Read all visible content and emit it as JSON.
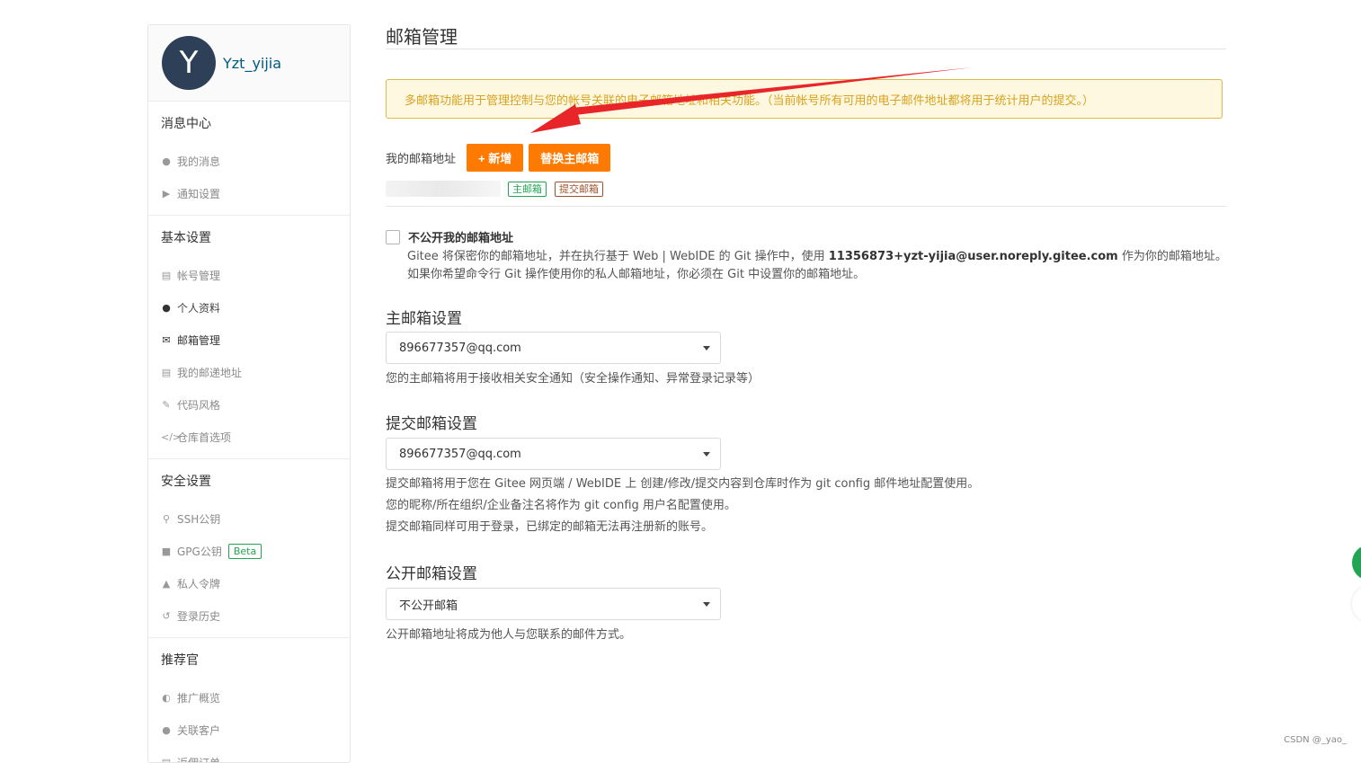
{
  "sidebar": {
    "avatar_letter": "Y",
    "username": "Yzt_yijia",
    "sections": [
      {
        "title": "消息中心",
        "items": [
          {
            "label": "我的消息",
            "icon": "bell-icon"
          },
          {
            "label": "通知设置",
            "icon": "speaker-icon"
          }
        ]
      },
      {
        "title": "基本设置",
        "items": [
          {
            "label": "帐号管理",
            "icon": "id-card-icon"
          },
          {
            "label": "个人资料",
            "icon": "user-icon"
          },
          {
            "label": "邮箱管理",
            "icon": "envelope-icon",
            "active": true
          },
          {
            "label": "我的邮递地址",
            "icon": "address-card-icon"
          },
          {
            "label": "代码风格",
            "icon": "brush-icon"
          },
          {
            "label": "仓库首选项",
            "icon": "code-icon"
          }
        ]
      },
      {
        "title": "安全设置",
        "items": [
          {
            "label": "SSH公钥",
            "icon": "key-icon"
          },
          {
            "label": "GPG公钥",
            "icon": "lock-icon",
            "badge": "Beta"
          },
          {
            "label": "私人令牌",
            "icon": "sitemap-icon"
          },
          {
            "label": "登录历史",
            "icon": "history-icon"
          }
        ]
      },
      {
        "title": "推荐官",
        "items": [
          {
            "label": "推广概览",
            "icon": "dashboard-icon"
          },
          {
            "label": "关联客户",
            "icon": "user-link-icon"
          },
          {
            "label": "返佣订单",
            "icon": "order-icon"
          }
        ]
      }
    ]
  },
  "main": {
    "title": "邮箱管理",
    "notice": "多邮箱功能用于管理控制与您的帐号关联的电子邮箱地址和相关功能。（当前帐号所有可用的电子邮件地址都将用于统计用户的提交。）",
    "my_email_label": "我的邮箱地址",
    "add_button": "+ 新增",
    "replace_button": "替换主邮箱",
    "tag_primary": "主邮箱",
    "tag_commit": "提交邮箱",
    "private_label": "不公开我的邮箱地址",
    "private_desc_1_pre": "Gitee 将保密你的邮箱地址，并在执行基于 Web | WebIDE 的 Git 操作中，使用 ",
    "private_desc_1_email": "11356873+yzt-yijia@user.noreply.gitee.com",
    "private_desc_1_post": " 作为你的邮箱地址。",
    "private_desc_2": "如果你希望命令行 Git 操作使用你的私人邮箱地址，你必须在 Git 中设置你的邮箱地址。",
    "primary_title": "主邮箱设置",
    "primary_value": "896677357@qq.com",
    "primary_help": "您的主邮箱将用于接收相关安全通知（安全操作通知、异常登录记录等）",
    "commit_title": "提交邮箱设置",
    "commit_value": "896677357@qq.com",
    "commit_help_1": "提交邮箱将用于您在 Gitee 网页端 / WebIDE 上 创建/修改/提交内容到仓库时作为 git config 邮件地址配置使用。",
    "commit_help_2": "您的昵称/所在组织/企业备注名将作为 git config 用户名配置使用。",
    "commit_help_3": "提交邮箱同样可用于登录，已绑定的邮箱无法再注册新的账号。",
    "public_title": "公开邮箱设置",
    "public_value": "不公开邮箱",
    "public_help": "公开邮箱地址将成为他人与您联系的邮件方式。"
  },
  "watermark": "CSDN @_yao_",
  "colors": {
    "accent": "#ff7a00",
    "annotation_arrow": "#e8262a",
    "link": "#005980",
    "success": "#21a552"
  }
}
